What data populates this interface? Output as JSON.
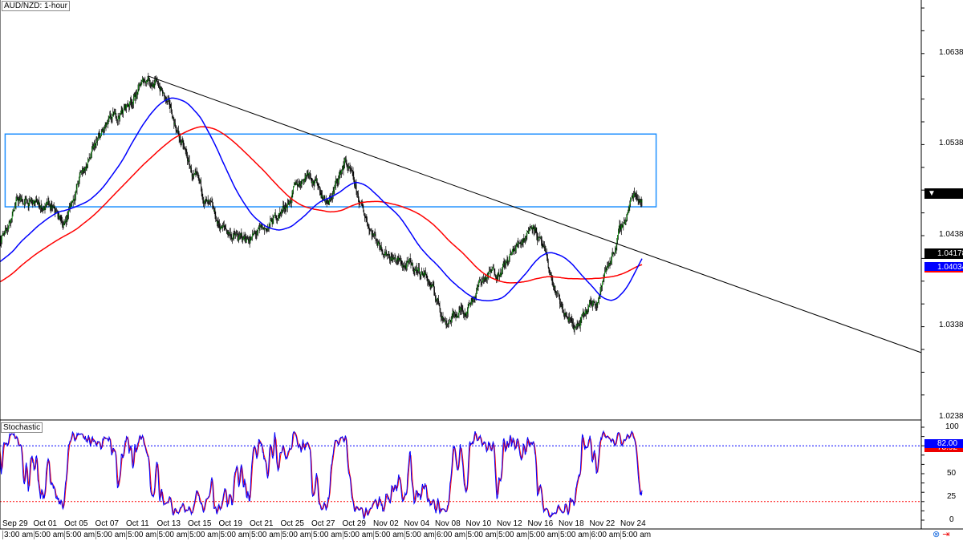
{
  "header": {
    "title": "AUD/NZD: 1-hour"
  },
  "stochastic": {
    "title": "Stochastic",
    "levels": [
      "100",
      "50",
      "25",
      "0"
    ],
    "value_label": "82.00",
    "signal_label": "78.92",
    "upper_level": 80,
    "lower_level": 20
  },
  "price_axis": {
    "labels": [
      "1.06385",
      "1.05385",
      "1.04385",
      "1.03385",
      "1.02385"
    ],
    "current": "1.04823",
    "ma_blue": "1.04178",
    "ma_red": "1.04034"
  },
  "time_axis": {
    "dates": [
      "Sep 29",
      "Oct 01",
      "Oct 05",
      "Oct 07",
      "Oct 11",
      "Oct 13",
      "Oct 15",
      "Oct 19",
      "Oct 21",
      "Oct 25",
      "Oct 27",
      "Oct 29",
      "Nov 02",
      "Nov 04",
      "Nov 08",
      "Nov 10",
      "Nov 12",
      "Nov 16",
      "Nov 18",
      "Nov 22",
      "Nov 24"
    ],
    "times": [
      "3:00 am",
      "5:00 am",
      "5:00 am",
      "5:00 am",
      "5:00 am",
      "5:00 am",
      "5:00 am",
      "5:00 am",
      "5:00 am",
      "5:00 am",
      "5:00 am",
      "5:00 am",
      "5:00 am",
      "5:00 am",
      "6:00 am",
      "5:00 am",
      "5:00 am",
      "5:00 am",
      "5:00 am",
      "6:00 am",
      "5:00 am"
    ]
  },
  "colors": {
    "bull": "#00a000",
    "bear": "#000000",
    "ma_fast": "#0000ff",
    "ma_slow": "#ff0000",
    "zone": "#1e90ff",
    "trendline": "#000000"
  },
  "chart_data": {
    "type": "candlestick",
    "symbol": "AUD/NZD",
    "timeframe": "1-hour",
    "ylim": [
      1.0218,
      1.07
    ],
    "price_path": [
      [
        -250,
        1.033
      ],
      [
        -100,
        1.038
      ],
      [
        0,
        1.04323
      ],
      [
        25,
        1.04764
      ],
      [
        75,
        1.04676
      ],
      [
        100,
        1.045
      ],
      [
        125,
        1.05028
      ],
      [
        162,
        1.05513
      ],
      [
        200,
        1.05821
      ],
      [
        231,
        1.0613
      ],
      [
        250,
        1.05997
      ],
      [
        275,
        1.05557
      ],
      [
        300,
        1.05028
      ],
      [
        338,
        1.045
      ],
      [
        375,
        1.04323
      ],
      [
        412,
        1.04412
      ],
      [
        431,
        1.04588
      ],
      [
        450,
        1.04764
      ],
      [
        481,
        1.05116
      ],
      [
        512,
        1.0472
      ],
      [
        538,
        1.05204
      ],
      [
        562,
        1.04676
      ],
      [
        588,
        1.04323
      ],
      [
        625,
        1.04059
      ],
      [
        662,
        1.03971
      ],
      [
        694,
        1.03442
      ],
      [
        725,
        1.03575
      ],
      [
        750,
        1.03883
      ],
      [
        788,
        1.04059
      ],
      [
        831,
        1.04544
      ],
      [
        850,
        1.04103
      ],
      [
        875,
        1.03531
      ],
      [
        900,
        1.03354
      ],
      [
        931,
        1.03707
      ],
      [
        956,
        1.04235
      ],
      [
        975,
        1.04588
      ],
      [
        988,
        1.04852
      ],
      [
        1000,
        1.04808
      ]
    ],
    "ma_fast_period": 100,
    "ma_slow_period": 200,
    "trendline": [
      [
        231,
        1.0613
      ],
      [
        1435,
        1.0309
      ]
    ],
    "resistance_zone": {
      "from_bar": 8,
      "to_bar": 1022,
      "top": 1.05493,
      "bottom": 1.04693
    },
    "stochastic_params": [
      14,
      3,
      3
    ]
  }
}
